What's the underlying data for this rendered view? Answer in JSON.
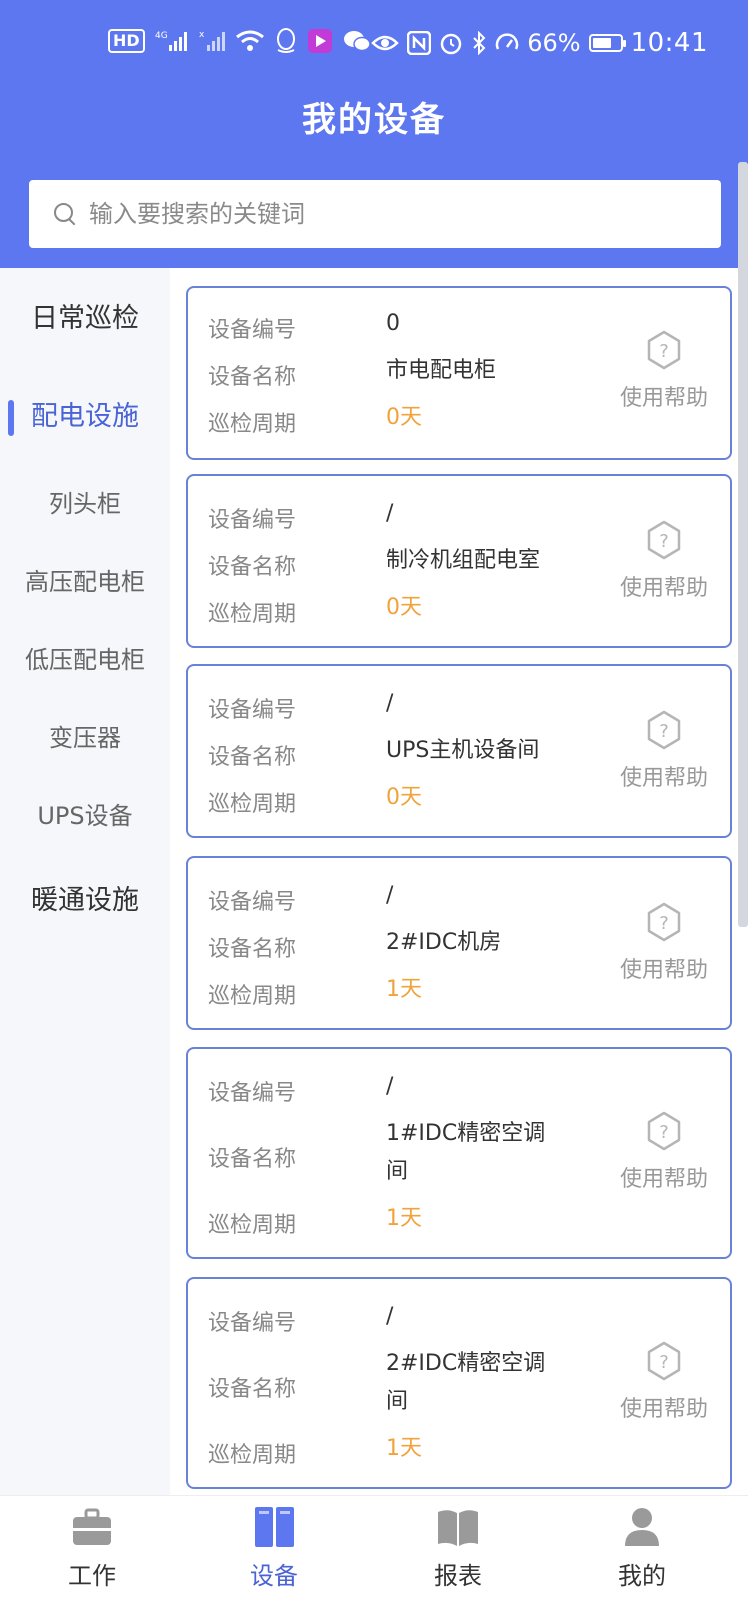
{
  "statusbar": {
    "left_indicators": [
      "HD",
      "4G signal",
      "signal",
      "wifi",
      "qq",
      "app",
      "wechat"
    ],
    "hd_label": "HD",
    "battery_percent": "66%",
    "time": "10:41"
  },
  "header": {
    "title": "我的设备"
  },
  "search": {
    "placeholder": "输入要搜索的关键词",
    "value": ""
  },
  "sidebar": {
    "items": [
      {
        "label": "日常巡检",
        "kind": "category"
      },
      {
        "label": "配电设施",
        "kind": "category",
        "active": true
      },
      {
        "label": "列头柜",
        "kind": "sub"
      },
      {
        "label": "高压配电柜",
        "kind": "sub"
      },
      {
        "label": "低压配电柜",
        "kind": "sub"
      },
      {
        "label": "变压器",
        "kind": "sub"
      },
      {
        "label": "UPS设备",
        "kind": "sub"
      },
      {
        "label": "暖通设施",
        "kind": "category"
      }
    ]
  },
  "labels": {
    "code": "设备编号",
    "name": "设备名称",
    "cycle": "巡检周期",
    "help": "使用帮助"
  },
  "devices": [
    {
      "code": "0",
      "name": "市电配电柜",
      "cycle": "0天"
    },
    {
      "code": "/",
      "name": "制冷机组配电室",
      "cycle": "0天"
    },
    {
      "code": "/",
      "name": "UPS主机设备间",
      "cycle": "0天"
    },
    {
      "code": "/",
      "name": "2#IDC机房",
      "cycle": "1天"
    },
    {
      "code": "/",
      "name": "1#IDC精密空调间",
      "cycle": "1天"
    },
    {
      "code": "/",
      "name": "2#IDC精密空调间",
      "cycle": "1天"
    }
  ],
  "bottom_nav": [
    {
      "label": "工作",
      "icon": "briefcase-icon"
    },
    {
      "label": "设备",
      "icon": "device-icon",
      "active": true
    },
    {
      "label": "报表",
      "icon": "book-icon"
    },
    {
      "label": "我的",
      "icon": "user-icon"
    }
  ],
  "colors": {
    "primary": "#5d77f0",
    "active_text": "#4a64d6",
    "cycle": "#f0a33a",
    "card_border": "#6a81d8"
  }
}
